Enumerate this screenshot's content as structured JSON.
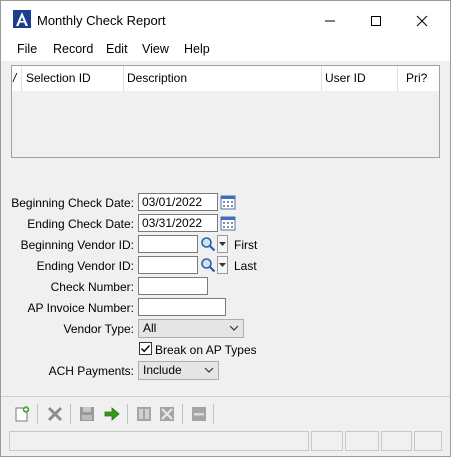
{
  "window": {
    "title": "Monthly Check Report",
    "icon": "app-logo-icon",
    "controls": [
      "minimize-icon",
      "maximize-icon",
      "close-icon"
    ]
  },
  "menu": {
    "items": [
      {
        "label": "File"
      },
      {
        "label": "Record"
      },
      {
        "label": "Edit"
      },
      {
        "label": "View"
      },
      {
        "label": "Help"
      }
    ]
  },
  "grid": {
    "columns": [
      {
        "label": "/"
      },
      {
        "label": "Selection ID"
      },
      {
        "label": "Description"
      },
      {
        "label": "User ID"
      },
      {
        "label": "Pri?"
      }
    ],
    "rows": []
  },
  "form": {
    "beginning_check_date": {
      "label": "Beginning Check Date:",
      "value": "03/01/2022"
    },
    "ending_check_date": {
      "label": "Ending Check Date:",
      "value": "03/31/2022"
    },
    "beginning_vendor_id": {
      "label": "Beginning Vendor ID:",
      "value": "",
      "hint": "First"
    },
    "ending_vendor_id": {
      "label": "Ending Vendor ID:",
      "value": "",
      "hint": "Last"
    },
    "check_number": {
      "label": "Check Number:",
      "value": ""
    },
    "ap_invoice_number": {
      "label": "AP Invoice Number:",
      "value": ""
    },
    "vendor_type": {
      "label": "Vendor Type:",
      "value": "All"
    },
    "break_on_ap_types": {
      "label": "Break on AP Types",
      "checked": true
    },
    "ach_payments": {
      "label": "ACH Payments:",
      "value": "Include"
    }
  },
  "toolbar": {
    "buttons": [
      "new-record-icon",
      "delete-icon",
      "save-icon",
      "run-icon",
      "copy-icon",
      "clear-icon",
      "collapse-icon"
    ]
  },
  "colors": {
    "background": "#f0f0f0",
    "accent_blue": "#1f4fa8",
    "run_green": "#3a9a1a"
  }
}
